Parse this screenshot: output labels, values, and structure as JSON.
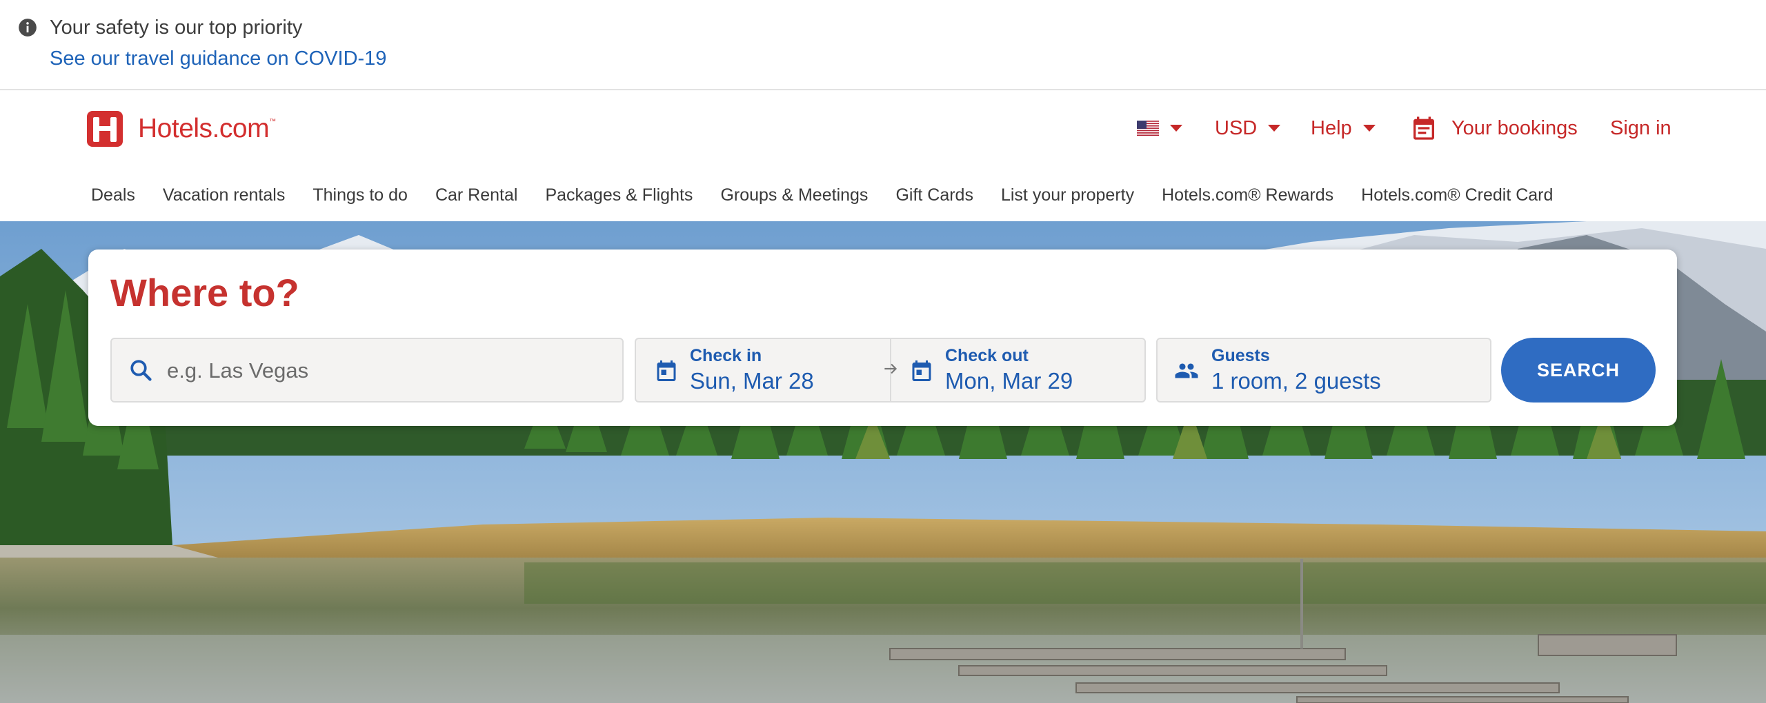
{
  "alert": {
    "title": "Your safety is our top priority",
    "link": "See our travel guidance on COVID-19",
    "icon": "info-icon"
  },
  "header": {
    "logo_text": "Hotels.com",
    "logo_tm": "™",
    "currency": "USD",
    "help": "Help",
    "bookings": "Your bookings",
    "sign_in": "Sign in",
    "brand_color": "#d32f2f",
    "icons": [
      "us-flag-icon",
      "calendar-icon"
    ]
  },
  "nav": {
    "items": [
      "Deals",
      "Vacation rentals",
      "Things to do",
      "Car Rental",
      "Packages & Flights",
      "Groups & Meetings",
      "Gift Cards",
      "List your property",
      "Hotels.com® Rewards",
      "Hotels.com® Credit Card"
    ]
  },
  "search": {
    "title": "Where to?",
    "destination_placeholder": "e.g. Las Vegas",
    "destination_value": "",
    "checkin_label": "Check in",
    "checkin_value": "Sun, Mar 28",
    "checkout_label": "Check out",
    "checkout_value": "Mon, Mar 29",
    "guests_label": "Guests",
    "guests_value": "1 room, 2 guests",
    "button": "SEARCH",
    "accent_color": "#2f6cc2",
    "icons": [
      "search-icon",
      "calendar-icon",
      "arrow-right-icon",
      "people-icon"
    ]
  }
}
